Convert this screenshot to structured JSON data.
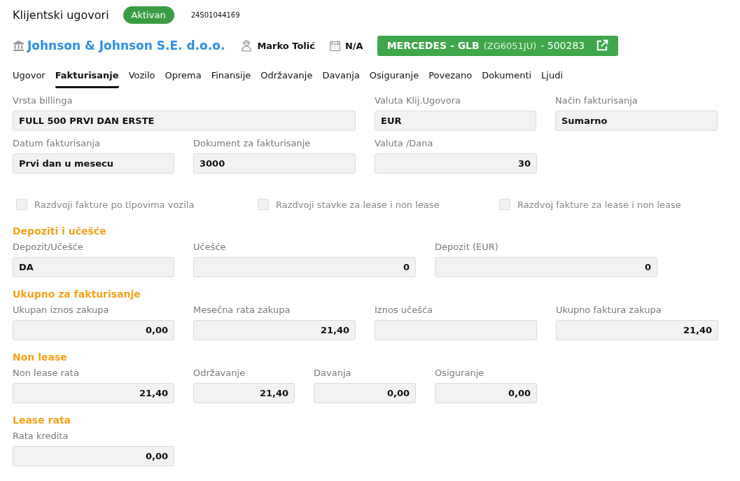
{
  "header": {
    "title": "Klijentski ugovori",
    "status": "Aktivan",
    "contract_number": "24S01044169"
  },
  "info": {
    "company": "Johnson & Johnson S.E. d.o.o.",
    "person": "Marko Tolić",
    "date": "N/A",
    "vehicle_model": "MERCEDES - GLB",
    "vehicle_plate": "(ZG6051JU)",
    "vehicle_number": "- 500283"
  },
  "tabs": [
    {
      "label": "Ugovor",
      "selected": false
    },
    {
      "label": "Fakturisanje",
      "selected": true
    },
    {
      "label": "Vozilo",
      "selected": false
    },
    {
      "label": "Oprema",
      "selected": false
    },
    {
      "label": "Finansije",
      "selected": false
    },
    {
      "label": "Održavanje",
      "selected": false
    },
    {
      "label": "Davanja",
      "selected": false
    },
    {
      "label": "Osiguranje",
      "selected": false
    },
    {
      "label": "Povezano",
      "selected": false
    },
    {
      "label": "Dokumenti",
      "selected": false
    },
    {
      "label": "Ljudi",
      "selected": false
    }
  ],
  "general_rows": [
    [
      {
        "label": "Vrsta billinga",
        "value": "FULL 500 PRVI DAN ERSTE",
        "kind": "text"
      },
      {
        "label": "Valuta Klij.Ugovora",
        "value": "EUR",
        "kind": "text"
      },
      {
        "label": "Način fakturisanja",
        "value": "Sumarno",
        "kind": "text"
      }
    ],
    [
      {
        "label": "Datum fakturisanja",
        "value": "Prvi dan u mesecu",
        "kind": "text"
      },
      {
        "label": "Dokument za fakturisanje",
        "value": "3000",
        "kind": "text"
      },
      {
        "label": "Valuta /Dana",
        "value": "30",
        "kind": "number"
      }
    ]
  ],
  "checkboxes": [
    {
      "label": "Razdvoji fakture po tipovima vozila",
      "checked": false
    },
    {
      "label": "Razdvoji stavke za lease i non lease",
      "checked": false
    },
    {
      "label": "Razdvoj fakture za lease i non lease",
      "checked": false
    }
  ],
  "sections": [
    {
      "title": "Depoziti i učešće",
      "fields": [
        {
          "label": "Depozit/Učešće",
          "value": "DA",
          "kind": "text"
        },
        {
          "label": "Učešće",
          "value": "0",
          "kind": "number"
        },
        {
          "label": "Depozit (EUR)",
          "value": "0",
          "kind": "number"
        }
      ]
    },
    {
      "title": "Ukupno za fakturisanje",
      "fields": [
        {
          "label": "Ukupan iznos zakupa",
          "value": "0,00",
          "kind": "number"
        },
        {
          "label": "Mesečna rata zakupa",
          "value": "21,40",
          "kind": "number"
        },
        {
          "label": "Iznos učešća",
          "kind": "number"
        },
        {
          "label": "Ukupno faktura zakupa",
          "value": "21,40",
          "kind": "number"
        }
      ]
    },
    {
      "title": "Non lease",
      "fields": [
        {
          "label": "Non lease rata",
          "value": "21,40",
          "kind": "number"
        },
        {
          "label": "Održavanje",
          "value": "21,40",
          "kind": "number"
        },
        {
          "label": "Davanja",
          "value": "0,00",
          "kind": "number"
        },
        {
          "label": "Osiguranje",
          "value": "0,00",
          "kind": "number"
        }
      ]
    },
    {
      "title": "Lease rata",
      "fields": [
        {
          "label": "Rata kredita",
          "value": "0,00",
          "kind": "number"
        }
      ]
    }
  ]
}
